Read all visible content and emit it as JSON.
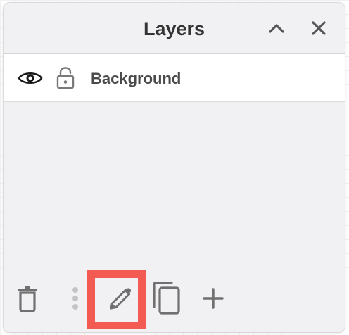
{
  "panel": {
    "title": "Layers",
    "collapse_icon": "chevron-up-icon",
    "close_icon": "close-icon"
  },
  "layers": [
    {
      "name": "Background",
      "visibility_icon": "eye-icon",
      "lock_icon": "unlocked-padlock-icon"
    }
  ],
  "toolbar": {
    "buttons": [
      {
        "name": "delete-layer-button",
        "icon": "trash-icon"
      },
      {
        "name": "more-options-button",
        "icon": "vertical-dots-icon"
      },
      {
        "name": "edit-layer-button",
        "icon": "pencil-icon"
      },
      {
        "name": "duplicate-layer-button",
        "icon": "duplicate-icon"
      },
      {
        "name": "add-layer-button",
        "icon": "plus-icon"
      }
    ]
  },
  "colors": {
    "panel_bg": "#f1f1f3",
    "row_bg": "#ffffff",
    "title_text": "#333333",
    "icon_gray": "#707070",
    "highlight": "#f25a52"
  }
}
